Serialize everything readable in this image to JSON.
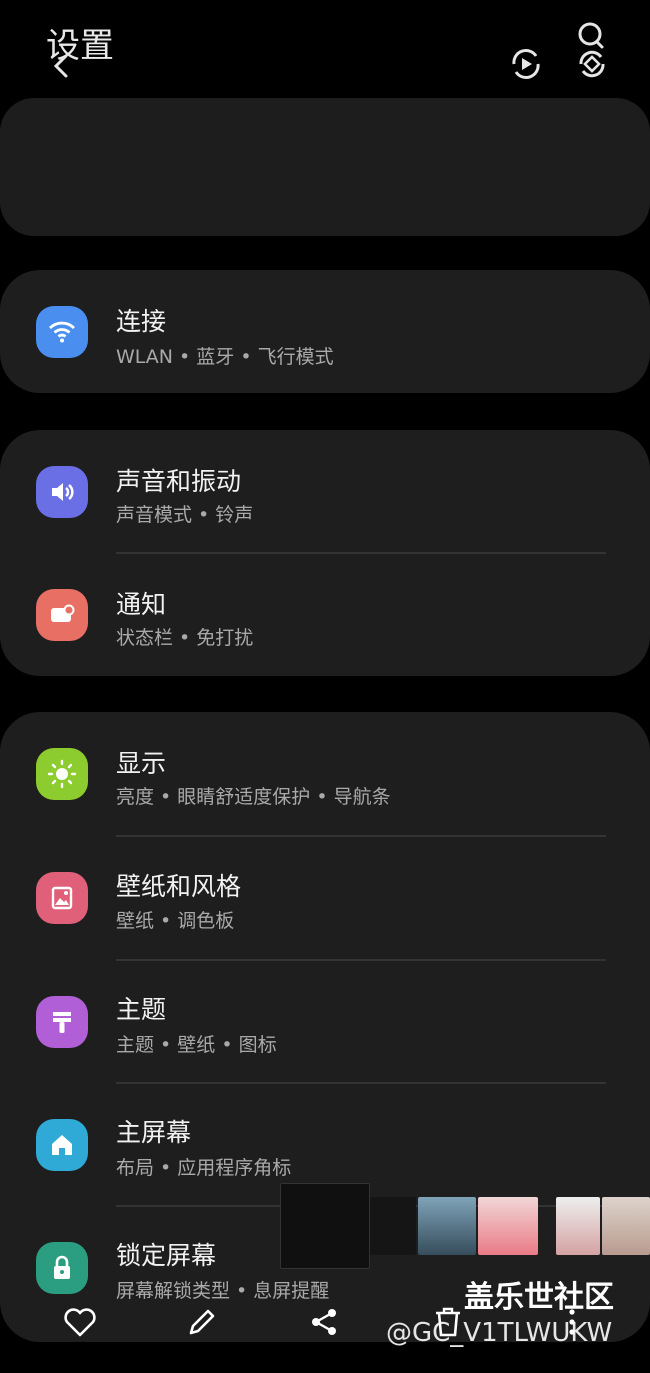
{
  "header": {
    "title": "设置",
    "icons": [
      "back-icon",
      "search-icon",
      "account-sync-icon",
      "refresh-icon"
    ]
  },
  "sections": [
    {
      "items": [
        {
          "label": "连接",
          "sub": "WLAN • 蓝牙 • 飞行模式",
          "icon": "wifi-icon",
          "color": "#4a8ff0"
        }
      ]
    },
    {
      "items": [
        {
          "label": "声音和振动",
          "sub": "声音模式 • 铃声",
          "icon": "volume-icon",
          "color": "#6b6fe6"
        },
        {
          "label": "通知",
          "sub": "状态栏 • 免打扰",
          "icon": "notification-icon",
          "color": "#e86f63"
        }
      ]
    },
    {
      "items": [
        {
          "label": "显示",
          "sub": "亮度 • 眼睛舒适度保护 • 导航条",
          "icon": "brightness-icon",
          "color": "#8ccc2f"
        },
        {
          "label": "壁纸和风格",
          "sub": "壁纸 • 调色板",
          "icon": "wallpaper-icon",
          "color": "#e0607a"
        },
        {
          "label": "主题",
          "sub": "主题 • 壁纸 • 图标",
          "icon": "theme-icon",
          "color": "#b05fd6"
        },
        {
          "label": "主屏幕",
          "sub": "布局 • 应用程序角标",
          "icon": "home-icon",
          "color": "#2fa9d6"
        },
        {
          "label": "锁定屏幕",
          "sub": "屏幕解锁类型 • 息屏提醒",
          "icon": "lock-icon",
          "color": "#2b9e82"
        }
      ]
    }
  ],
  "bottom_bar": {
    "icons": [
      "heart-icon",
      "edit-icon",
      "share-icon",
      "delete-icon",
      "more-icon"
    ]
  },
  "watermark": {
    "site": "盖乐世社区",
    "user": "@GC_V1TLWUKW"
  }
}
